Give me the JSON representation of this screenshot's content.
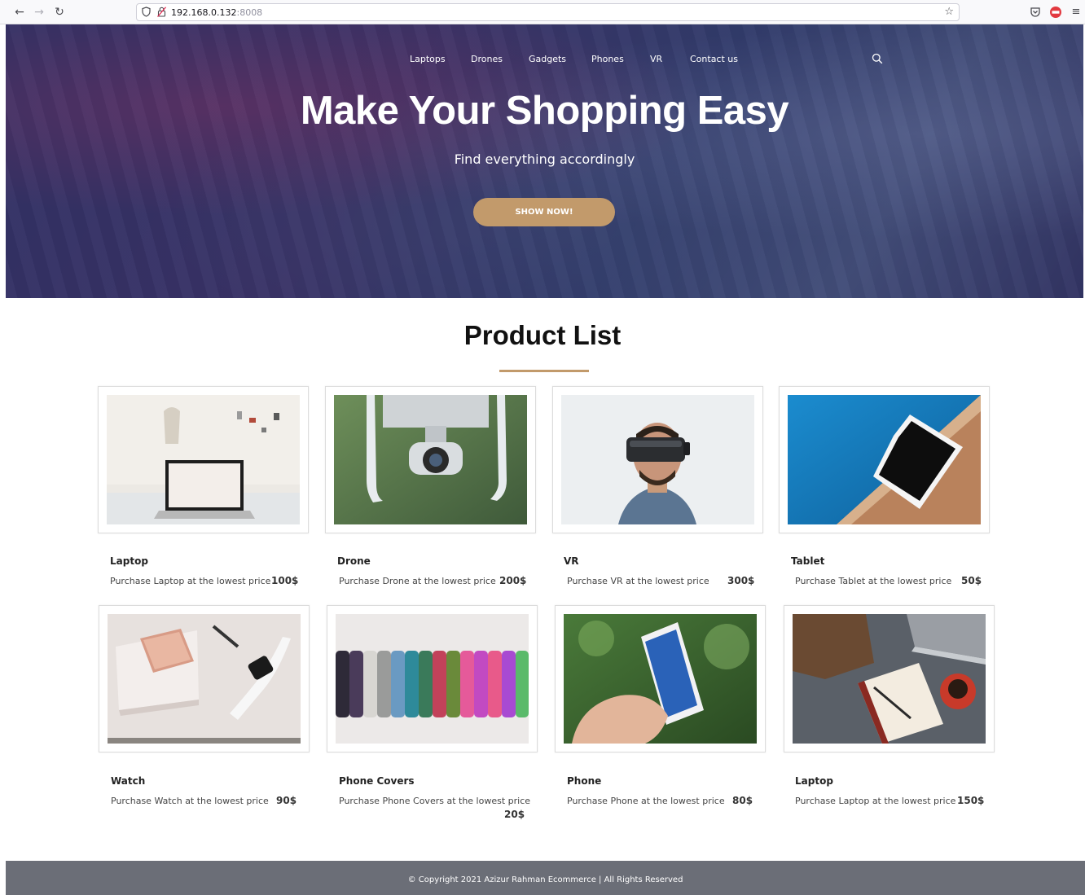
{
  "browser": {
    "url_host": "192.168.0.132",
    "url_port": ":8008"
  },
  "nav": {
    "items": [
      {
        "label": "Laptops"
      },
      {
        "label": "Drones"
      },
      {
        "label": "Gadgets"
      },
      {
        "label": "Phones"
      },
      {
        "label": "VR"
      },
      {
        "label": "Contact us"
      }
    ]
  },
  "hero": {
    "title": "Make Your Shopping Easy",
    "subtitle": "Find everything accordingly",
    "button_label": "SHOW NOW!"
  },
  "product_list": {
    "title": "Product List",
    "accent": "#c29a6b",
    "products": [
      {
        "name": "Laptop",
        "description": "Purchase Laptop at the lowest price",
        "price": "100$",
        "image": "laptop-photo"
      },
      {
        "name": "Drone",
        "description": "Purchase Drone at the lowest price",
        "price": "200$",
        "image": "drone-photo"
      },
      {
        "name": "VR",
        "description": "Purchase VR at the lowest price",
        "price": "300$",
        "image": "vr-headset-photo"
      },
      {
        "name": "Tablet",
        "description": "Purchase Tablet at the lowest price",
        "price": "50$",
        "image": "tablet-photo"
      },
      {
        "name": "Watch",
        "description": "Purchase Watch at the lowest price",
        "price": "90$",
        "image": "watch-photo"
      },
      {
        "name": "Phone Covers",
        "description": "Purchase Phone Covers at the lowest price",
        "price": "20$",
        "image": "phone-covers-photo"
      },
      {
        "name": "Phone",
        "description": "Purchase Phone at the lowest price",
        "price": "80$",
        "image": "phone-photo"
      },
      {
        "name": "Laptop",
        "description": "Purchase Laptop at the lowest price",
        "price": "150$",
        "image": "laptop-desk-photo"
      }
    ]
  },
  "footer": {
    "text": "© Copyright 2021 Azizur Rahman Ecommerce | All Rights Reserved"
  }
}
